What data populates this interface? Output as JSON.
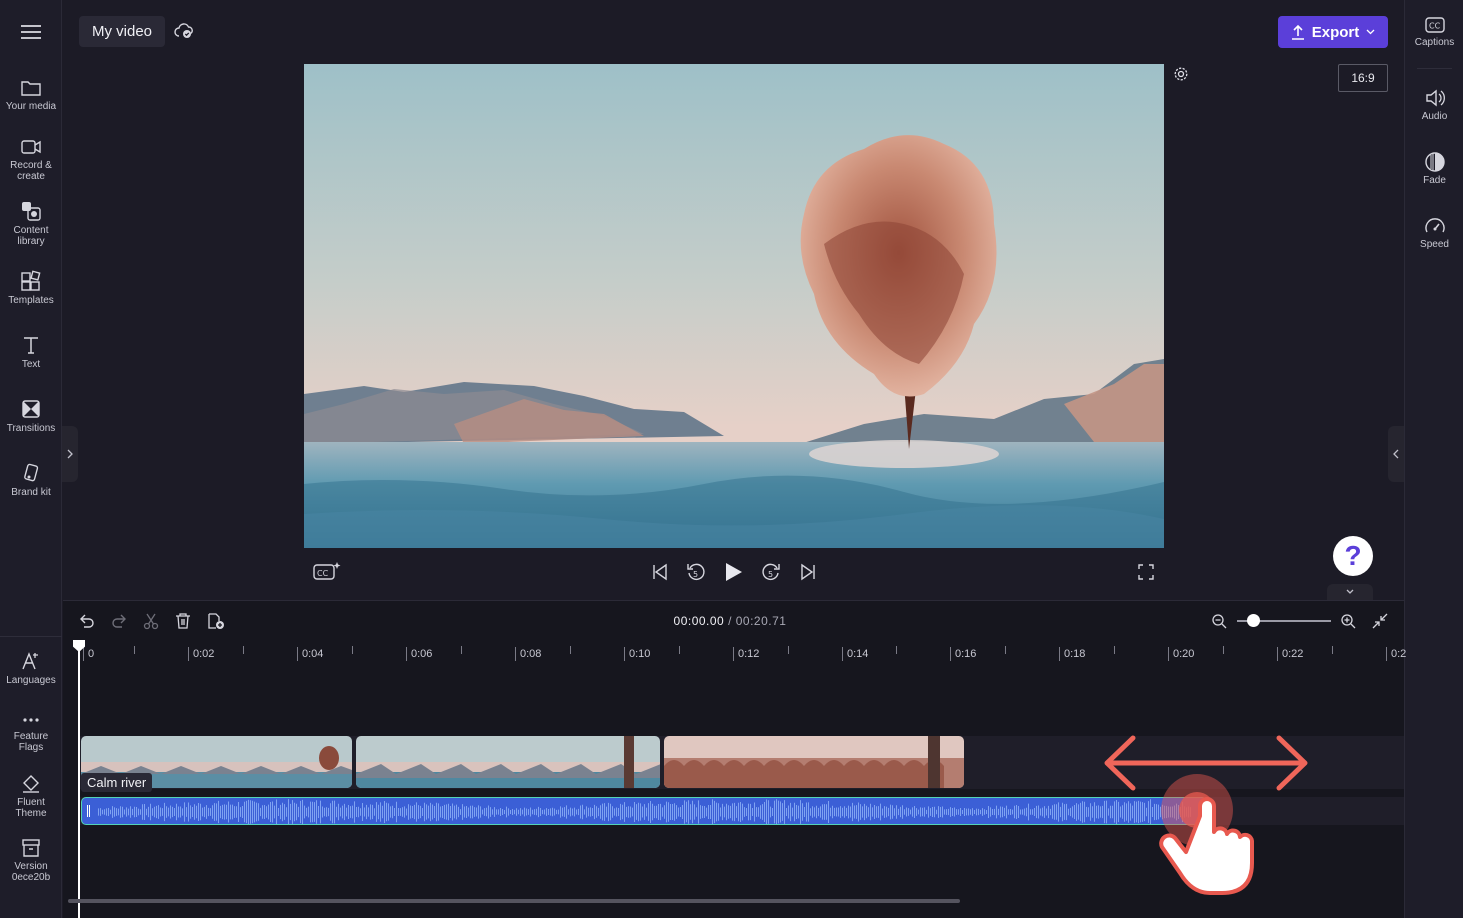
{
  "header": {
    "project_title": "My video",
    "export_label": "Export",
    "aspect_ratio": "16:9"
  },
  "left_sidebar": {
    "items": [
      {
        "label": "Your media",
        "icon": "folder-icon"
      },
      {
        "label": "Record &",
        "label2": "create",
        "icon": "camera-icon"
      },
      {
        "label": "Content",
        "label2": "library",
        "icon": "content-library-icon"
      },
      {
        "label": "Templates",
        "icon": "templates-icon"
      },
      {
        "label": "Text",
        "icon": "text-icon"
      },
      {
        "label": "Transitions",
        "icon": "transitions-icon"
      },
      {
        "label": "Brand kit",
        "icon": "brand-kit-icon"
      }
    ],
    "bottom_items": [
      {
        "label": "Languages",
        "icon": "languages-icon"
      },
      {
        "label": "Feature",
        "label2": "Flags",
        "icon": "more-icon"
      },
      {
        "label": "Fluent",
        "label2": "Theme",
        "icon": "paint-bucket-icon"
      },
      {
        "label": "Version",
        "label2": "0ece20b",
        "icon": "archive-icon"
      }
    ]
  },
  "right_sidebar": {
    "items": [
      {
        "label": "Captions",
        "icon": "captions-icon"
      },
      {
        "label": "Audio",
        "icon": "speaker-icon"
      },
      {
        "label": "Fade",
        "icon": "fade-icon"
      },
      {
        "label": "Speed",
        "icon": "speedometer-icon"
      }
    ]
  },
  "player": {
    "help_label": "?"
  },
  "timeline": {
    "current_time": "00:00.00",
    "total_time": "/ 00:20.71",
    "ticks": [
      "0",
      "0:02",
      "0:04",
      "0:06",
      "0:08",
      "0:10",
      "0:12",
      "0:14",
      "0:16",
      "0:18",
      "0:20",
      "0:22",
      "0:2"
    ],
    "audio_clip_label": "Calm river"
  },
  "colors": {
    "accent": "#5b3fd9",
    "audio_clip": "#3b5fd6",
    "audio_border": "#53d3b8",
    "drag_arrow": "#f0665a"
  }
}
